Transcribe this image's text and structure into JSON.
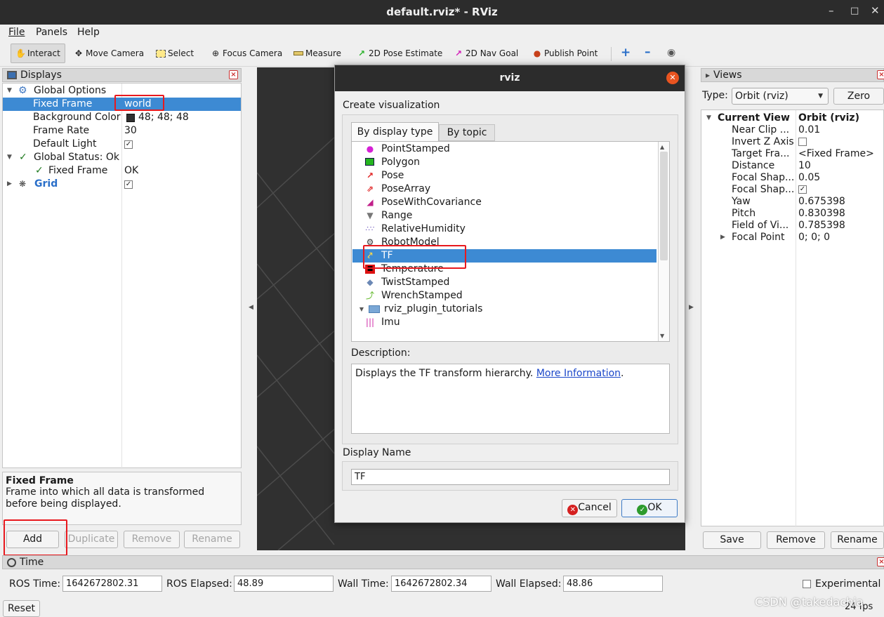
{
  "window": {
    "title": "default.rviz* - RViz"
  },
  "menu": [
    "File",
    "Panels",
    "Help"
  ],
  "toolbar": {
    "interact": "Interact",
    "move_camera": "Move Camera",
    "select": "Select",
    "focus_camera": "Focus Camera",
    "measure": "Measure",
    "pose_estimate": "2D Pose Estimate",
    "nav_goal": "2D Nav Goal",
    "publish_point": "Publish Point"
  },
  "displays": {
    "title": "Displays",
    "global_options": "Global Options",
    "fixed_frame_label": "Fixed Frame",
    "fixed_frame_value": "world",
    "background_color_label": "Background Color",
    "background_color_value": "48; 48; 48",
    "frame_rate_label": "Frame Rate",
    "frame_rate_value": "30",
    "default_light_label": "Default Light",
    "global_status": "Global Status: Ok",
    "status_fixed_frame": "Fixed Frame",
    "status_fixed_frame_value": "OK",
    "grid": "Grid",
    "desc_title": "Fixed Frame",
    "desc_text": "Frame into which all data is transformed before being displayed.",
    "buttons": {
      "add": "Add",
      "duplicate": "Duplicate",
      "remove": "Remove",
      "rename": "Rename"
    }
  },
  "dialog": {
    "title": "rviz",
    "create_label": "Create visualization",
    "tabs": [
      "By display type",
      "By topic"
    ],
    "items": [
      {
        "label": "PointStamped",
        "icon": "point-stamped-icon"
      },
      {
        "label": "Polygon",
        "icon": "polygon-icon"
      },
      {
        "label": "Pose",
        "icon": "pose-icon"
      },
      {
        "label": "PoseArray",
        "icon": "pose-array-icon"
      },
      {
        "label": "PoseWithCovariance",
        "icon": "pose-covariance-icon"
      },
      {
        "label": "Range",
        "icon": "range-icon"
      },
      {
        "label": "RelativeHumidity",
        "icon": "humidity-icon"
      },
      {
        "label": "RobotModel",
        "icon": "robot-model-icon"
      },
      {
        "label": "TF",
        "icon": "tf-icon"
      },
      {
        "label": "Temperature",
        "icon": "temperature-icon"
      },
      {
        "label": "TwistStamped",
        "icon": "twist-icon"
      },
      {
        "label": "WrenchStamped",
        "icon": "wrench-icon"
      }
    ],
    "folder": "rviz_plugin_tutorials",
    "folder_item": "Imu",
    "description_label": "Description:",
    "description_text": "Displays the TF transform hierarchy.",
    "more_info": "More Information",
    "display_name_label": "Display Name",
    "display_name_value": "TF",
    "cancel": "Cancel",
    "ok": "OK"
  },
  "views": {
    "title": "Views",
    "type_label": "Type:",
    "type_value": "Orbit (rviz)",
    "zero": "Zero",
    "current_view": "Current View",
    "current_view_value": "Orbit (rviz)",
    "props": [
      {
        "k": "Near Clip ...",
        "v": "0.01"
      },
      {
        "k": "Invert Z Axis",
        "v": ""
      },
      {
        "k": "Target Fra...",
        "v": "<Fixed Frame>"
      },
      {
        "k": "Distance",
        "v": "10"
      },
      {
        "k": "Focal Shap...",
        "v": "0.05"
      },
      {
        "k": "Focal Shap...",
        "v": ""
      },
      {
        "k": "Yaw",
        "v": "0.675398"
      },
      {
        "k": "Pitch",
        "v": "0.830398"
      },
      {
        "k": "Field of Vi...",
        "v": "0.785398"
      },
      {
        "k": "Focal Point",
        "v": "0; 0; 0"
      }
    ],
    "buttons": {
      "save": "Save",
      "remove": "Remove",
      "rename": "Rename"
    }
  },
  "time": {
    "title": "Time",
    "ros_time_label": "ROS Time:",
    "ros_time": "1642672802.31",
    "ros_elapsed_label": "ROS Elapsed:",
    "ros_elapsed": "48.89",
    "wall_time_label": "Wall Time:",
    "wall_time": "1642672802.34",
    "wall_elapsed_label": "Wall Elapsed:",
    "wall_elapsed": "48.86",
    "experimental": "Experimental",
    "reset": "Reset",
    "fps": "24 fps"
  },
  "watermark": "CSDN @takedachia"
}
